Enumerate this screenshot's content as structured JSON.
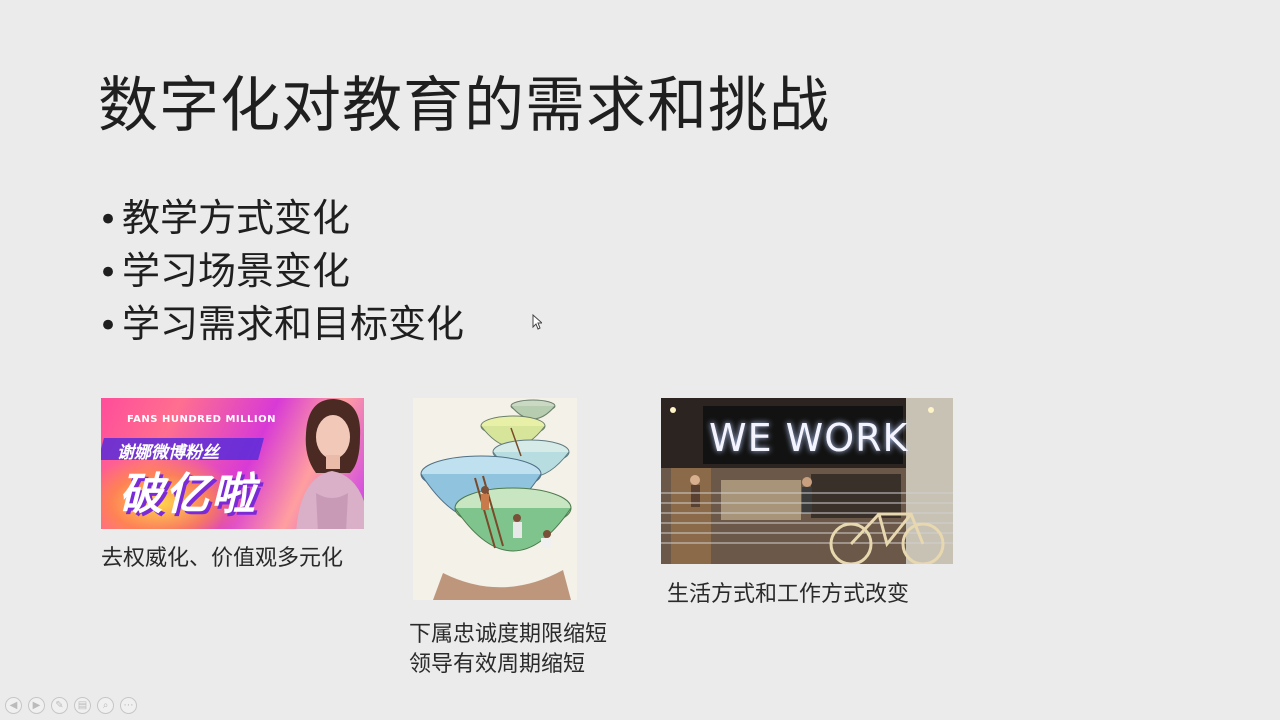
{
  "slide": {
    "title": "数字化对教育的需求和挑战",
    "bullets": [
      {
        "label": "教学方式变化"
      },
      {
        "label": "学习场景变化"
      },
      {
        "label": "学习需求和目标变化"
      }
    ],
    "pictures": [
      {
        "caption": "去权威化、价值观多元化",
        "overlay_small": "FANS HUNDRED MILLION",
        "overlay_mid": "谢娜微博粉丝",
        "overlay_big": "破亿啦"
      },
      {
        "caption_line1": "下属忠诚度期限缩短",
        "caption_line2": "领导有效周期缩短"
      },
      {
        "caption": "生活方式和工作方式改变",
        "sign_text": "WE WORK"
      }
    ]
  },
  "toolbar": {
    "icons": [
      "prev-icon",
      "next-icon",
      "pen-icon",
      "slides-icon",
      "zoom-icon",
      "more-icon"
    ],
    "glyphs": [
      "◀",
      "▶",
      "✎",
      "▤",
      "⌕",
      "⋯"
    ]
  },
  "colors": {
    "background": "#ebebeb",
    "text": "#1f1f1f"
  }
}
